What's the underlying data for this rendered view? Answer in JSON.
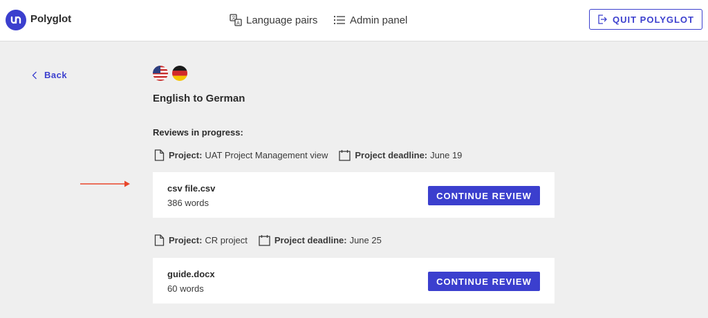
{
  "header": {
    "app_name": "Polyglot",
    "nav": [
      {
        "label": "Language pairs",
        "icon": "translate-icon"
      },
      {
        "label": "Admin panel",
        "icon": "list-icon"
      }
    ],
    "quit_label": "QUIT POLYGLOT"
  },
  "back_label": "Back",
  "pair": {
    "source_flag": "us-flag-icon",
    "target_flag": "de-flag-icon",
    "title": "English to German"
  },
  "section_title": "Reviews in progress:",
  "projects": [
    {
      "project_label": "Project:",
      "project_name": "UAT Project Management view",
      "deadline_label": "Project deadline:",
      "deadline": "June 19",
      "files": [
        {
          "name": "csv file.csv",
          "words": "386 words",
          "button": "CONTINUE REVIEW"
        }
      ]
    },
    {
      "project_label": "Project:",
      "project_name": "CR project",
      "deadline_label": "Project deadline:",
      "deadline": "June 25",
      "files": [
        {
          "name": "guide.docx",
          "words": "60 words",
          "button": "CONTINUE REVIEW"
        }
      ]
    }
  ],
  "colors": {
    "accent": "#3b3fce",
    "background": "#efefef",
    "annotation_arrow": "#e8462a"
  }
}
